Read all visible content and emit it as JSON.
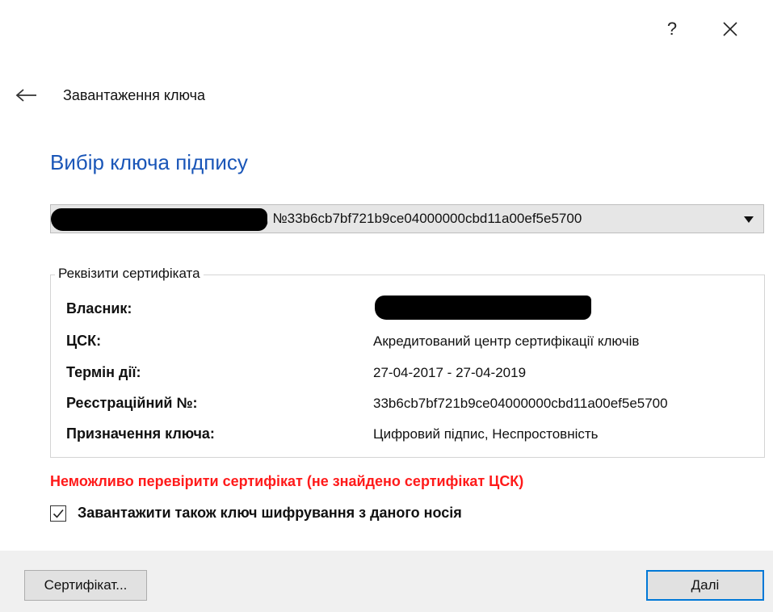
{
  "window": {
    "help_label": "?",
    "close_icon": "close-icon"
  },
  "nav": {
    "back_icon": "back-arrow-icon",
    "title": "Завантаження ключа"
  },
  "page": {
    "title": "Вибір ключа підпису"
  },
  "key_select": {
    "selected_value": ", №33b6cb7bf721b9ce04000000cbd11a00ef5e5700",
    "redacted": true
  },
  "certificate": {
    "legend": "Реквізити сертифіката",
    "rows": [
      {
        "label": "Власник:",
        "value": "",
        "redacted": true
      },
      {
        "label": "ЦСК:",
        "value": "Акредитований центр сертифікації ключів"
      },
      {
        "label": "Термін дії:",
        "value": "27-04-2017 - 27-04-2019"
      },
      {
        "label": "Реєстраційний №:",
        "value": "33b6cb7bf721b9ce04000000cbd11a00ef5e5700"
      },
      {
        "label": "Призначення ключа:",
        "value": "Цифровий підпис, Неспростовність"
      }
    ]
  },
  "error": {
    "text": "Неможливо перевірити сертифікат (не знайдено сертифікат ЦСК)",
    "color": "#ff1a1a"
  },
  "encryption_key": {
    "label": "Завантажити також ключ шифрування з даного носія",
    "checked": true
  },
  "buttons": {
    "certificate": "Сертифікат...",
    "next": "Далі"
  },
  "colors": {
    "title": "#1a56b8",
    "accent": "#0078d7",
    "footer_bg": "#f0f0f0"
  }
}
